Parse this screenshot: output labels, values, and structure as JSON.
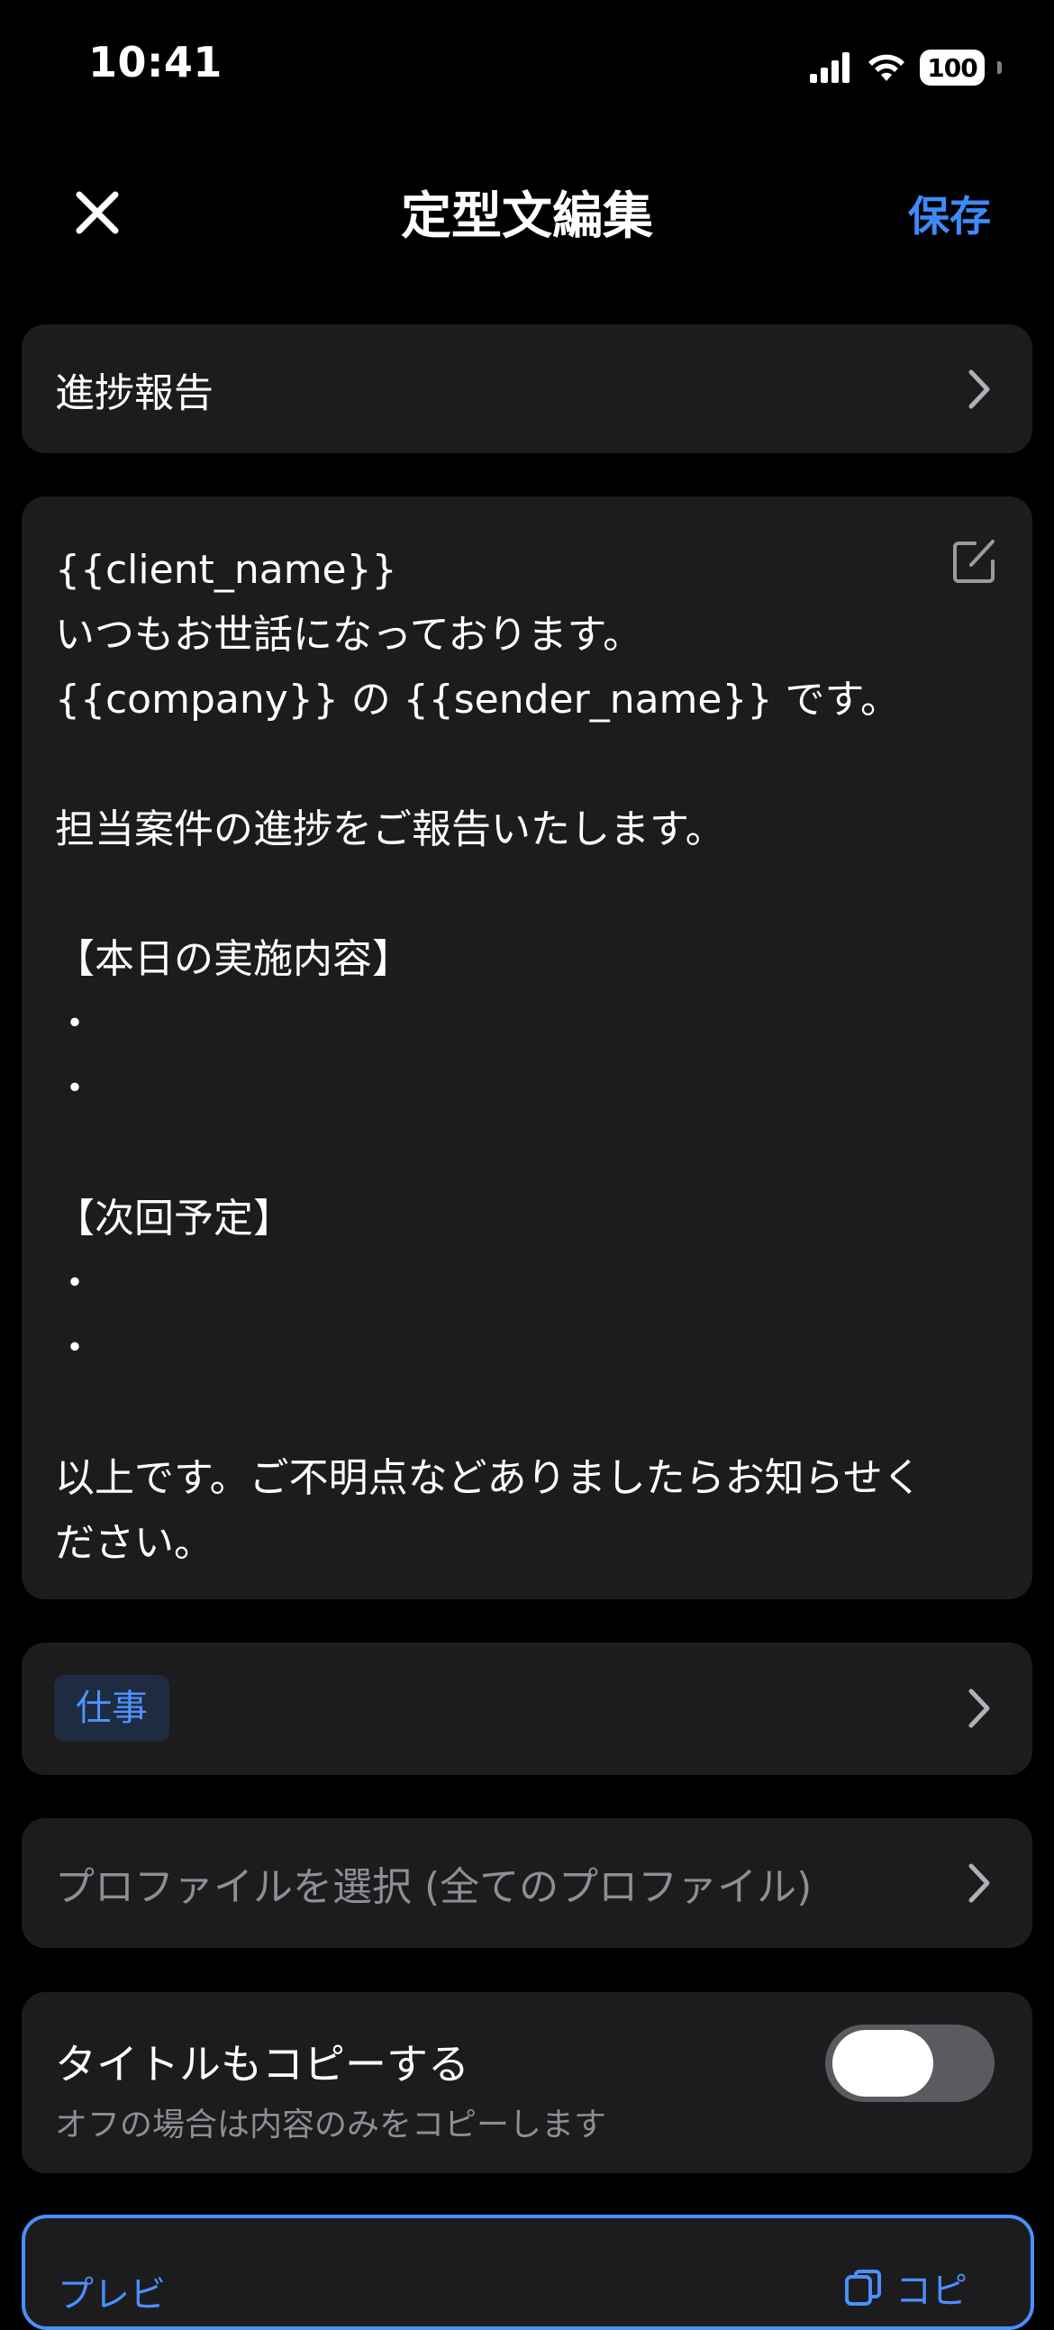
{
  "status_bar": {
    "time": "10:41",
    "battery": "100"
  },
  "nav": {
    "title": "定型文編集",
    "save_label": "保存"
  },
  "category": {
    "label": "進捗報告"
  },
  "template_body": {
    "text": "{{client_name}}\nいつもお世話になっております。\n{{company}} の {{sender_name}} です。\n\n担当案件の進捗をご報告いたします。\n\n【本日の実施内容】\n・\n・\n\n【次回予定】\n・\n・\n\n以上です。ご不明点などありましたらお知らせください。"
  },
  "tag_row": {
    "tag": "仕事"
  },
  "profile_row": {
    "placeholder": "プロファイルを選択 (全てのプロファイル)"
  },
  "copy_title": {
    "title": "タイトルもコピーする",
    "subtitle": "オフの場合は内容のみをコピーします",
    "enabled": false
  },
  "preview": {
    "label": "プレビ",
    "copy_label": "コピ"
  },
  "colors": {
    "accent": "#3d8bfd",
    "card": "#1c1c1e",
    "background": "#000000",
    "secondary_text": "#8e8e93"
  }
}
